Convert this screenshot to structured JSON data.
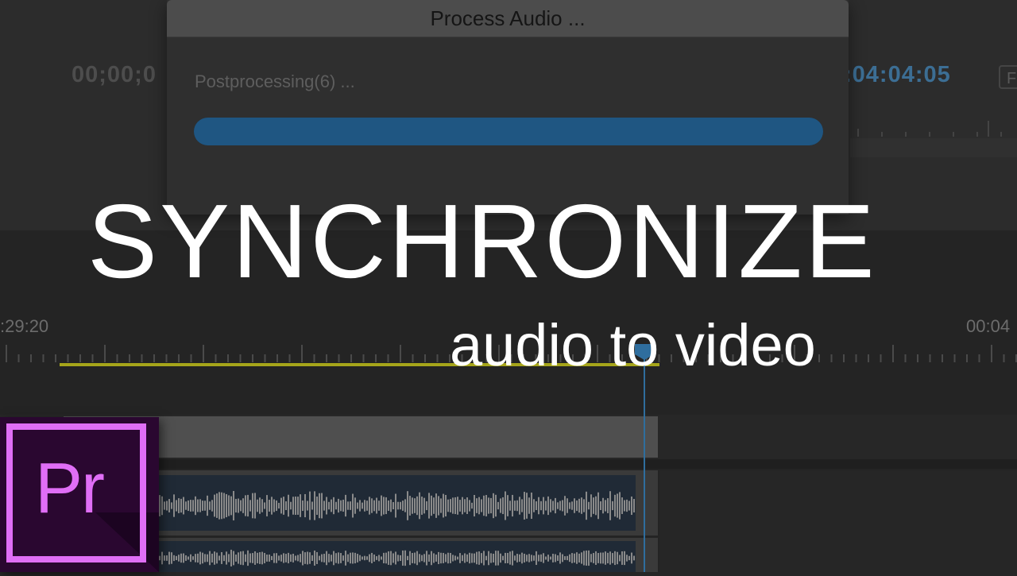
{
  "monitor": {
    "timecode_left": "00;00;0",
    "timecode_right": ":04:04:05",
    "fit_dropdown_label": "F"
  },
  "dialog": {
    "title": "Process Audio ...",
    "status": "Postprocessing(6) ...",
    "progress_fraction": 1.0
  },
  "timeline": {
    "timecode_left": ":29:20",
    "timecode_right": "00:04"
  },
  "overlay": {
    "headline": "SYNCHRONIZE",
    "subheadline": "audio to video"
  },
  "logo": {
    "text": "Pr"
  },
  "colors": {
    "progress_fill": "#1f5682",
    "playhead": "#2f6e9e",
    "work_area": "#a6a51a",
    "logo_accent": "#e06ef6",
    "logo_bg": "#2a0730"
  }
}
